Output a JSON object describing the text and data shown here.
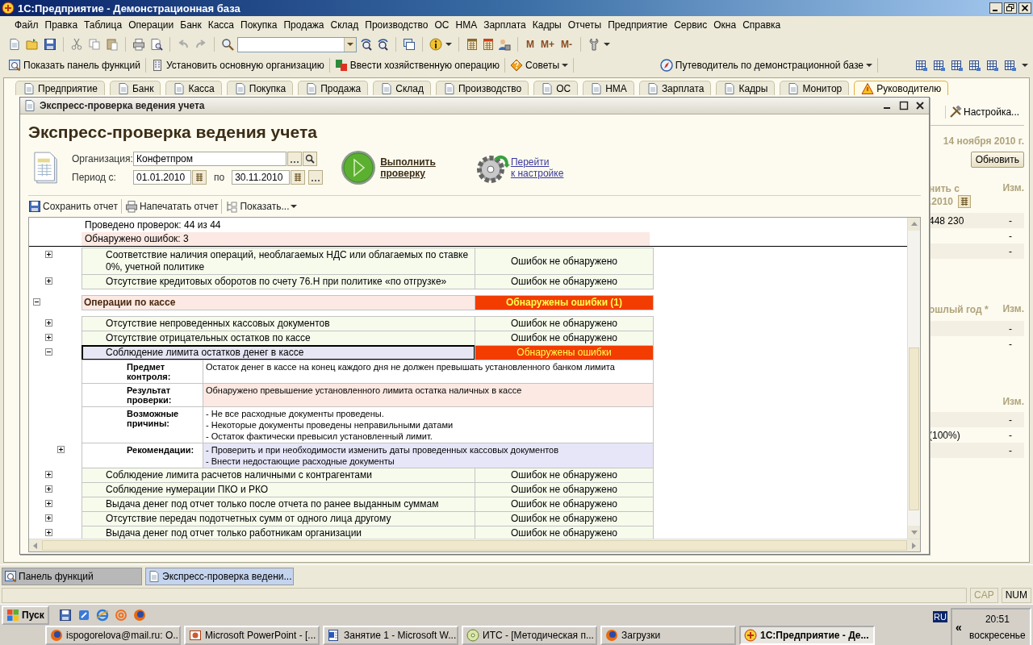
{
  "app_window": {
    "title": "1С:Предприятие - Демонстрационная база"
  },
  "menu": [
    "Файл",
    "Правка",
    "Таблица",
    "Операции",
    "Банк",
    "Касса",
    "Покупка",
    "Продажа",
    "Склад",
    "Производство",
    "ОС",
    "НМА",
    "Зарплата",
    "Кадры",
    "Отчеты",
    "Предприятие",
    "Сервис",
    "Окна",
    "Справка"
  ],
  "toolbar": {
    "memory_buttons": [
      "M",
      "M+",
      "M-"
    ]
  },
  "command_bar": [
    {
      "label": "Показать панель функций",
      "dropdown": false
    },
    {
      "label": "Установить основную организацию",
      "dropdown": false
    },
    {
      "label": "Ввести хозяйственную операцию",
      "dropdown": false
    },
    {
      "label": "Советы",
      "dropdown": true
    },
    {
      "label": "Путеводитель по демонстрационной базе",
      "dropdown": true
    }
  ],
  "section_tabs": [
    {
      "label": "Предприятие",
      "selected": false
    },
    {
      "label": "Банк",
      "selected": false
    },
    {
      "label": "Касса",
      "selected": false
    },
    {
      "label": "Покупка",
      "selected": false
    },
    {
      "label": "Продажа",
      "selected": false
    },
    {
      "label": "Склад",
      "selected": false
    },
    {
      "label": "Производство",
      "selected": false
    },
    {
      "label": "ОС",
      "selected": false
    },
    {
      "label": "НМА",
      "selected": false
    },
    {
      "label": "Зарплата",
      "selected": false
    },
    {
      "label": "Кадры",
      "selected": false
    },
    {
      "label": "Монитор",
      "selected": false
    },
    {
      "label": "Руководителю",
      "selected": true
    }
  ],
  "background_panel": {
    "settings_button": "Настройка...",
    "date": "14 ноября 2010 г.",
    "refresh_button": "Обновить",
    "tables": [
      {
        "heading_lines": [
          "нить с",
          ".2010"
        ],
        "calendar": true,
        "change_heading": "Изм.",
        "rows": [
          {
            "value": "448 230",
            "change": "-"
          },
          {
            "change": "-"
          },
          {
            "change": "-"
          }
        ]
      },
      {
        "heading_lines": [
          "ошлый год *"
        ],
        "calendar": false,
        "change_heading": "Изм.",
        "rows": [
          {
            "change": "-"
          },
          {
            "change": "-"
          }
        ]
      },
      {
        "calendar": false,
        "change_heading": "Изм.",
        "rows": [
          {
            "change": "-"
          },
          {
            "value": "(100%)",
            "change": "-"
          },
          {
            "change": "-"
          }
        ]
      }
    ]
  },
  "dialog": {
    "title": "Экспресс-проверка ведения учета",
    "heading": "Экспресс-проверка ведения учета",
    "organization_label": "Организация:",
    "organization": "Конфетпром",
    "period_label": "Период с:",
    "date_from": "01.01.2010",
    "to_label": "по",
    "date_to": "30.11.2010",
    "run_link": [
      "Выполнить",
      "проверку"
    ],
    "settings_link": [
      "Перейти",
      "к настройке"
    ],
    "toolbar": [
      {
        "label": "Сохранить отчет",
        "dropdown": false
      },
      {
        "label": "Напечатать отчет",
        "dropdown": false
      },
      {
        "label": "Показать...",
        "dropdown": true
      }
    ],
    "report": {
      "summary": [
        {
          "text": "Проведено проверок: 44 из 44",
          "highlighted": false
        },
        {
          "text": "Обнаружено ошибок: 3",
          "highlighted": true
        }
      ],
      "items": [
        {
          "kind": "continued",
          "children": [
            {
              "kind": "check",
              "title": "Соответствие наличия операций, необлагаемых НДС или облагаемых по ставке 0%, учетной политике",
              "status": "Ошибок не обнаружено",
              "errors": false,
              "expanded": false,
              "selected": false
            },
            {
              "kind": "check",
              "title": "Отсутствие кредитовых оборотов по счету 76.Н при политике «по отгрузке»",
              "status": "Ошибок не обнаружено",
              "errors": false,
              "expanded": false,
              "selected": false
            }
          ]
        },
        {
          "kind": "group",
          "title": "Операции по кассе",
          "status": "Обнаружены ошибки (1)",
          "errors": true,
          "expanded": true,
          "children": [
            {
              "kind": "check",
              "title": "Отсутствие непроведенных кассовых документов",
              "status": "Ошибок не обнаружено",
              "errors": false,
              "expanded": false,
              "selected": false
            },
            {
              "kind": "check",
              "title": "Отсутствие отрицательных остатков по кассе",
              "status": "Ошибок не обнаружено",
              "errors": false,
              "expanded": false,
              "selected": false
            },
            {
              "kind": "check",
              "title": "Соблюдение лимита остатков денег в кассе",
              "status": "Обнаружены ошибки",
              "errors": true,
              "expanded": true,
              "selected": true,
              "details": [
                {
                  "label": "Предмет контроля:",
                  "lines": [
                    "Остаток денег в кассе на конец каждого дня не должен превышать установленного банком лимита"
                  ],
                  "color": "#ffffff",
                  "toggle": false
                },
                {
                  "label": "Результат проверки:",
                  "lines": [
                    "Обнаружено превышение установленного лимита остатка наличных в кассе"
                  ],
                  "color": "#fce9e3",
                  "toggle": false
                },
                {
                  "label": "Возможные причины:",
                  "lines": [
                    "- Не все расходные документы проведены.",
                    "- Некоторые документы проведены неправильными датами",
                    "- Остаток фактически превысил установленный лимит."
                  ],
                  "color": "#ffffff",
                  "toggle": false
                },
                {
                  "label": "Рекомендации:",
                  "lines": [
                    "- Проверить и при необходимости изменить даты проведенных кассовых документов",
                    "- Внести недостающие расходные документы"
                  ],
                  "color": "#e6e6f8",
                  "toggle": true
                }
              ]
            },
            {
              "kind": "check",
              "title": "Соблюдение лимита расчетов наличными с контрагентами",
              "status": "Ошибок не обнаружено",
              "errors": false,
              "expanded": false,
              "selected": false
            },
            {
              "kind": "check",
              "title": "Соблюдение нумерации ПКО и РКО",
              "status": "Ошибок не обнаружено",
              "errors": false,
              "expanded": false,
              "selected": false
            },
            {
              "kind": "check",
              "title": "Выдача денег под отчет только после отчета по ранее выданным суммам",
              "status": "Ошибок не обнаружено",
              "errors": false,
              "expanded": false,
              "selected": false
            },
            {
              "kind": "check",
              "title": "Отсутствие передач подотчетных сумм от одного лица другому",
              "status": "Ошибок не обнаружено",
              "errors": false,
              "expanded": false,
              "selected": false
            },
            {
              "kind": "check",
              "title": "Выдача денег под отчет только работникам организации",
              "status": "Ошибок не обнаружено",
              "errors": false,
              "expanded": false,
              "selected": false
            }
          ]
        }
      ]
    }
  },
  "window_bar": [
    {
      "label": "Панель функций",
      "selected": false
    },
    {
      "label": "Экспресс-проверка ведени...",
      "selected": true
    }
  ],
  "status_bar": [
    {
      "label": "CAP",
      "on": false
    },
    {
      "label": "NUM",
      "on": true
    }
  ],
  "taskbar": {
    "start": "Пуск",
    "tasks": [
      {
        "label": "ispogorelova@mail.ru: О...",
        "selected": false
      },
      {
        "label": "Microsoft PowerPoint - [...",
        "selected": false
      },
      {
        "label": "Занятие 1 - Microsoft W...",
        "selected": false
      },
      {
        "label": "ИТС - [Методическая п...",
        "selected": false
      },
      {
        "label": "Загрузки",
        "selected": false
      },
      {
        "label": "1С:Предприятие - Де...",
        "selected": true
      }
    ],
    "language": "RU",
    "tray_toggle": "«",
    "time": "20:51",
    "day": "воскресенье"
  }
}
